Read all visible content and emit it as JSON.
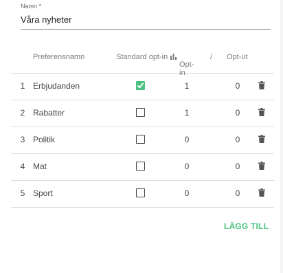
{
  "name_field": {
    "label": "Namn *",
    "value": "Våra nyheter"
  },
  "table": {
    "headers": {
      "name": "Preferensnamn",
      "default_optin": "Standard opt-in",
      "optin": "Opt-in",
      "separator": "/",
      "optout": "Opt-ut"
    },
    "rows": [
      {
        "index": "1",
        "name": "Erbjudanden",
        "default_optin": true,
        "optin": "1",
        "optout": "0"
      },
      {
        "index": "2",
        "name": "Rabatter",
        "default_optin": false,
        "optin": "1",
        "optout": "0"
      },
      {
        "index": "3",
        "name": "Politik",
        "default_optin": false,
        "optin": "0",
        "optout": "0"
      },
      {
        "index": "4",
        "name": "Mat",
        "default_optin": false,
        "optin": "0",
        "optout": "0"
      },
      {
        "index": "5",
        "name": "Sport",
        "default_optin": false,
        "optin": "0",
        "optout": "0"
      }
    ]
  },
  "add_button": {
    "label": "LÄGG TILL"
  },
  "colors": {
    "accent": "#4cc282",
    "text": "#444444",
    "muted": "#7a7a7a",
    "divider": "#dcdcdc"
  },
  "icons": {
    "stats": "bar-chart-icon",
    "delete": "trash-icon"
  }
}
